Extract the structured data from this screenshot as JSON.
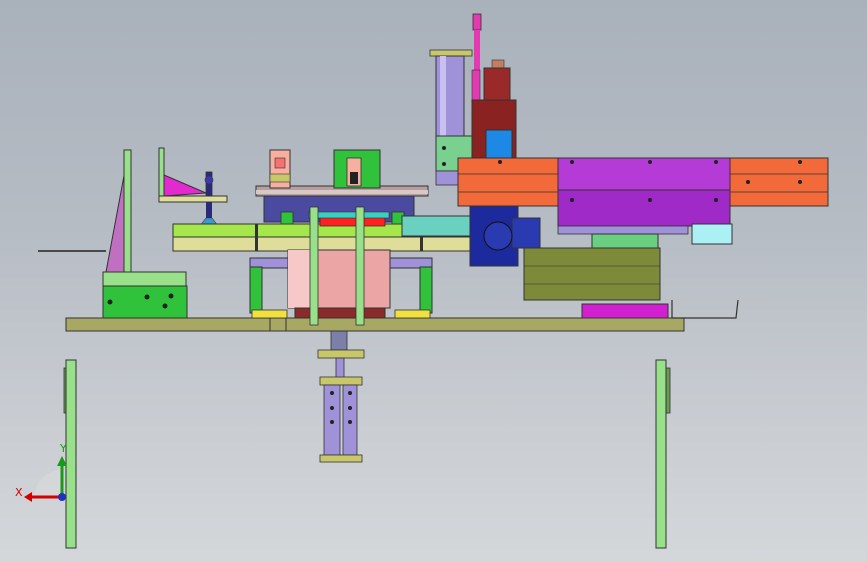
{
  "viewport": {
    "background": "gradient-gray",
    "model": "cad-assembly-front-view"
  },
  "triad": {
    "x_label": "X",
    "y_label": "Y",
    "x_color": "#d40000",
    "y_color": "#1a9a1a"
  },
  "colors": {
    "frame_olive": "#a8a865",
    "leg_green": "#99e08a",
    "cylinder_purple": "#9f92d8",
    "slide_orange": "#f26a3a",
    "carriage_magenta": "#b43bd6",
    "motor_olive": "#7d8a3a",
    "rotary_pink": "#eba5a5",
    "servo_blue": "#1d2a9e",
    "tube_pink": "#e23ab0"
  }
}
